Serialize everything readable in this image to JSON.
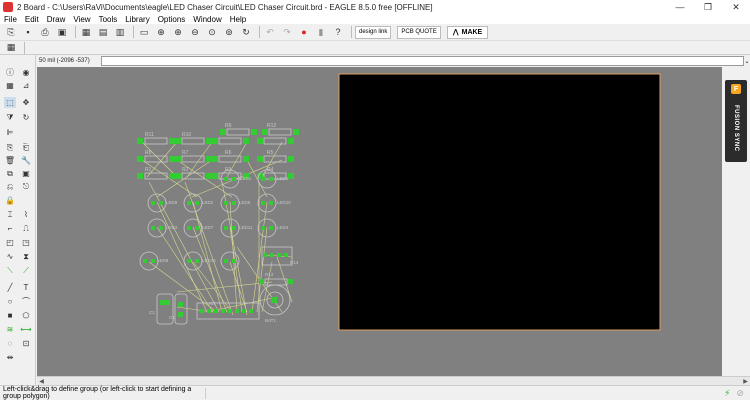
{
  "window": {
    "title": "2 Board - C:\\Users\\RaVi\\Documents\\eagle\\LED Chaser Circuit\\LED Chaser Circuit.brd - EAGLE 8.5.0 free [OFFLINE]",
    "minimize": "—",
    "maximize": "❐",
    "close": "✕"
  },
  "menu": [
    "File",
    "Edit",
    "Draw",
    "View",
    "Tools",
    "Library",
    "Options",
    "Window",
    "Help"
  ],
  "toolbar": {
    "design_link_label": "design link",
    "pcb_quote_label": "PCB QUOTE",
    "make_label": "MAKE"
  },
  "command": {
    "grid_readout": "50 mil (-2096 -537)",
    "value": "",
    "dropdown": "⌄"
  },
  "fusion": {
    "icon": "F",
    "label": "FUSION SYNC"
  },
  "board": {
    "outline_color": "#e0a060",
    "fill_color": "#000000"
  },
  "components": {
    "resistors": [
      "R11",
      "R10",
      "R9",
      "R12",
      "R8",
      "R7",
      "R6",
      "R5",
      "R1",
      "R2",
      "R3",
      "R4"
    ],
    "leds": [
      "LED1",
      "LED5",
      "LED9",
      "LED2",
      "LED6",
      "LED10",
      "LED3",
      "LED7",
      "LED11",
      "LED4",
      "LED8",
      "LED12"
    ],
    "other": [
      "R13",
      "C1",
      "IC1",
      "BAT1",
      "C2",
      "R14"
    ]
  },
  "status": {
    "text": "Left-click&drag to define group (or left-click to start defining a group polygon)"
  },
  "colors": {
    "canvas_bg": "#808080",
    "ratsnest": "#d8d890",
    "pad": "#33cc33",
    "silk": "#c8c8c8"
  }
}
